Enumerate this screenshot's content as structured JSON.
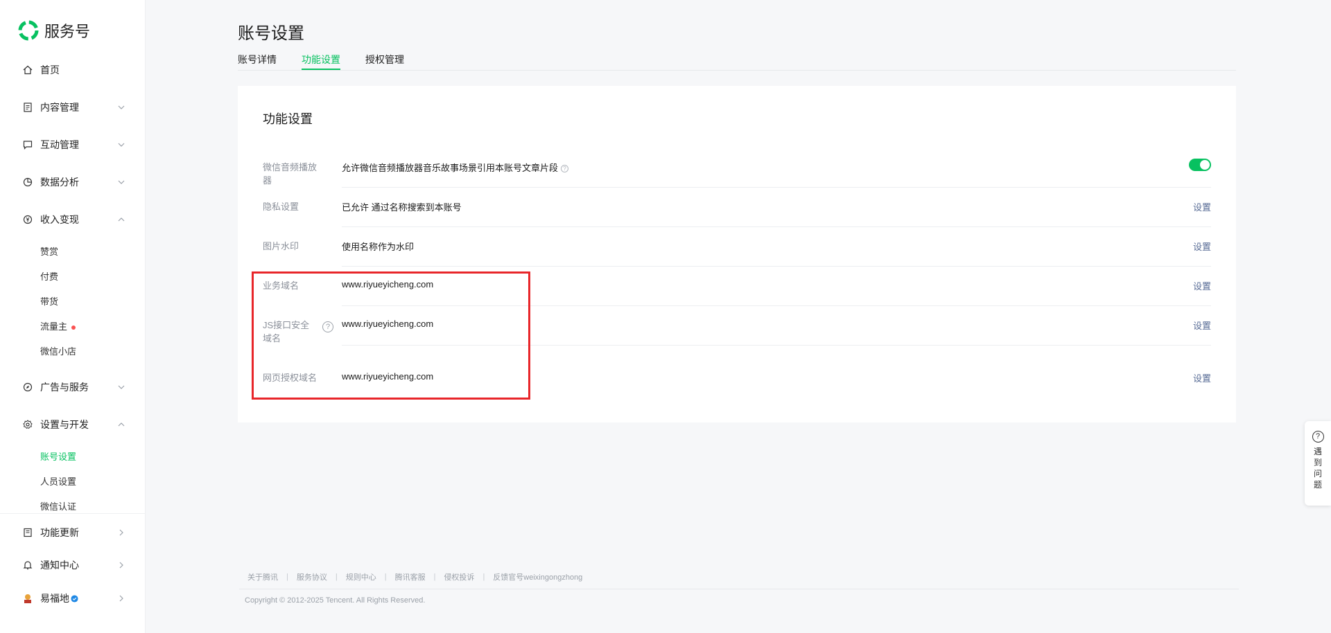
{
  "brand": {
    "name": "服务号"
  },
  "sidebar": {
    "items": [
      {
        "label": "首页",
        "icon": "home-icon"
      },
      {
        "label": "内容管理",
        "icon": "document-icon"
      },
      {
        "label": "互动管理",
        "icon": "chat-icon"
      },
      {
        "label": "数据分析",
        "icon": "pie-chart-icon"
      },
      {
        "label": "收入变现",
        "icon": "yen-icon"
      },
      {
        "label": "广告与服务",
        "icon": "compass-icon"
      },
      {
        "label": "设置与开发",
        "icon": "gear-icon"
      },
      {
        "label": "功能更新",
        "icon": "update-icon"
      },
      {
        "label": "通知中心",
        "icon": "bell-icon"
      },
      {
        "label": "易福地",
        "icon": "avatar"
      }
    ],
    "income_sub": [
      "赞赏",
      "付费",
      "带货",
      "流量主",
      "微信小店"
    ],
    "settings_sub": [
      "账号设置",
      "人员设置",
      "微信认证"
    ]
  },
  "page": {
    "title": "账号设置",
    "tabs": [
      "账号详情",
      "功能设置",
      "授权管理"
    ],
    "active_tab": "功能设置"
  },
  "card": {
    "title": "功能设置",
    "rows": [
      {
        "label": "微信音频播放器",
        "value": "允许微信音频播放器音乐故事场景引用本账号文章片段",
        "action": ""
      },
      {
        "label": "隐私设置",
        "value": "已允许 通过名称搜索到本账号",
        "action": "设置"
      },
      {
        "label": "图片水印",
        "value": "使用名称作为水印",
        "action": "设置"
      },
      {
        "label": "业务域名",
        "value": "www.riyueyicheng.com",
        "action": "设置"
      },
      {
        "label": "JS接口安全域名",
        "value": "www.riyueyicheng.com",
        "action": "设置"
      },
      {
        "label": "网页授权域名",
        "value": "www.riyueyicheng.com",
        "action": "设置"
      }
    ],
    "audio_toggle_on": true,
    "help_mark": "?"
  },
  "footer": {
    "links": [
      "关于腾讯",
      "服务协议",
      "规则中心",
      "腾讯客服",
      "侵权投诉",
      "反馈官号weixingongzhong"
    ],
    "separator": "|",
    "copyright": "Copyright © 2012-2025 Tencent. All Rights Reserved."
  },
  "help_float": {
    "icon": "?",
    "text": "遇到问题"
  },
  "colors": {
    "accent": "#07c160",
    "link": "#576b95",
    "highlight_box": "#e8262a"
  }
}
